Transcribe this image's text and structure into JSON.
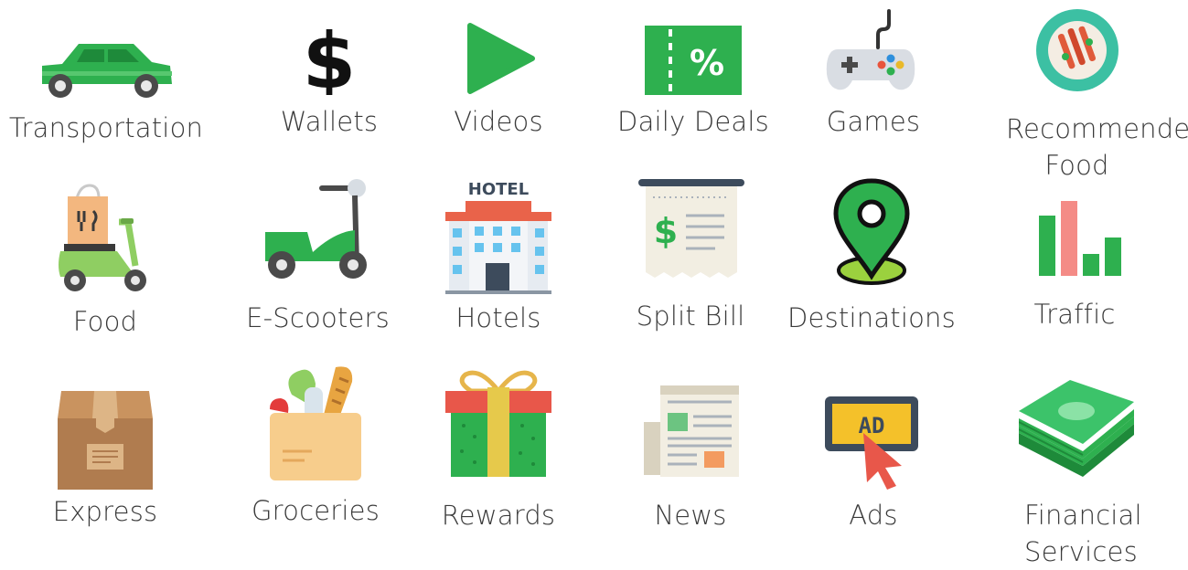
{
  "tiles": [
    {
      "label": "Transportation",
      "icon": "car-icon"
    },
    {
      "label": "Wallets",
      "icon": "dollar-sign-icon"
    },
    {
      "label": "Videos",
      "icon": "play-icon"
    },
    {
      "label": "Daily Deals",
      "icon": "discount-ticket-icon"
    },
    {
      "label": "Games",
      "icon": "gamepad-icon"
    },
    {
      "label": "Recommended Food",
      "icon": "food-plate-icon"
    },
    {
      "label": "Food",
      "icon": "delivery-scooter-icon"
    },
    {
      "label": "E-Scooters",
      "icon": "e-scooter-icon"
    },
    {
      "label": "Hotels",
      "icon": "hotel-icon",
      "sign": "HOTEL"
    },
    {
      "label": "Split Bill",
      "icon": "receipt-icon"
    },
    {
      "label": "Destinations",
      "icon": "map-pin-icon"
    },
    {
      "label": "Traffic",
      "icon": "bar-chart-icon"
    },
    {
      "label": "Express",
      "icon": "parcel-box-icon"
    },
    {
      "label": "Groceries",
      "icon": "grocery-bag-icon"
    },
    {
      "label": "Rewards",
      "icon": "gift-icon"
    },
    {
      "label": "News",
      "icon": "newspaper-icon"
    },
    {
      "label": "Ads",
      "icon": "ad-click-icon",
      "sign": "AD"
    },
    {
      "label": "Financial Services",
      "icon": "money-stack-icon"
    }
  ],
  "colors": {
    "green": "#2eb04f",
    "text": "#3a3a3a"
  }
}
